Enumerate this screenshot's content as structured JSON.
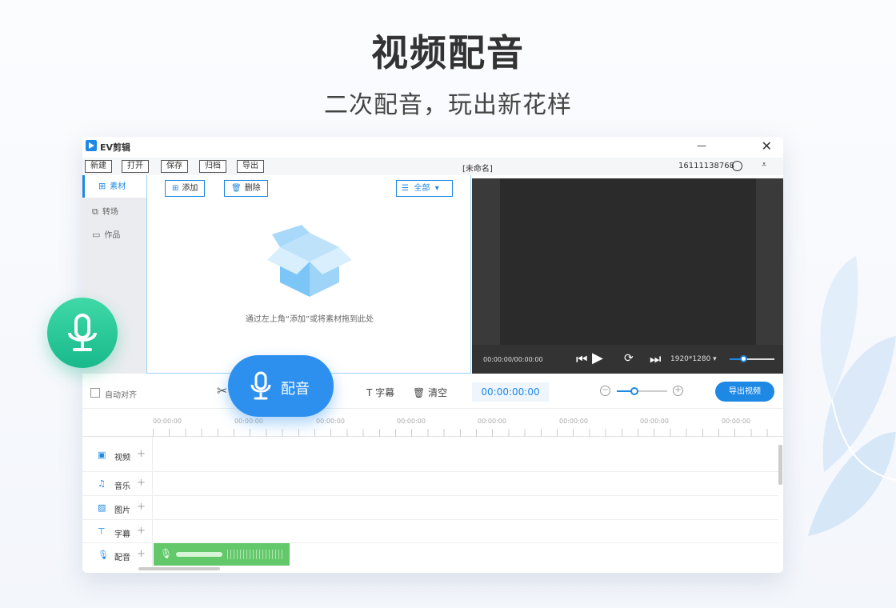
{
  "hero": {
    "title": "视频配音",
    "subtitle": "二次配音，玩出新花样"
  },
  "window": {
    "app_name": "EV剪辑",
    "minimize": "—",
    "close": "✕",
    "doc_name": "[未命名]",
    "user_id": "16111138768"
  },
  "menu": [
    "新建",
    "打开",
    "保存",
    "归档",
    "导出"
  ],
  "sidebar": [
    {
      "label": "素材",
      "icon": "grid-icon",
      "active": true
    },
    {
      "label": "转场",
      "icon": "transition-icon",
      "active": false
    },
    {
      "label": "作品",
      "icon": "folder-icon",
      "active": false
    }
  ],
  "media": {
    "add_label": "添加",
    "delete_label": "删除",
    "filter_label": "全部",
    "empty_hint": "通过左上角“添加”或将素材拖到此处"
  },
  "player": {
    "timecode": "00:00:00/00:00:00",
    "resolution": "1920*1280",
    "volume_level": 0.3
  },
  "toolbar": {
    "auto_align": "自动对齐",
    "subtitle_label": "字幕",
    "clear_label": "清空",
    "time": "00:00:00:00",
    "zoom_level": 0.35,
    "export_label": "导出视频",
    "dub_label": "配音"
  },
  "ruler": [
    "00:00:00",
    "00:00:00",
    "00:00:00",
    "00:00:00",
    "00:00:00",
    "00:00:00",
    "00:00:00",
    "00:00:00"
  ],
  "tracks": [
    {
      "label": "视频",
      "icon": "video-icon"
    },
    {
      "label": "音乐",
      "icon": "music-icon"
    },
    {
      "label": "图片",
      "icon": "image-icon"
    },
    {
      "label": "字幕",
      "icon": "text-icon"
    },
    {
      "label": "配音",
      "icon": "mic-icon"
    }
  ],
  "colors": {
    "accent": "#1e88e5",
    "mic_green": "#19b98c",
    "dub_blue": "#2e90ee",
    "clip_green": "#63c86a"
  }
}
